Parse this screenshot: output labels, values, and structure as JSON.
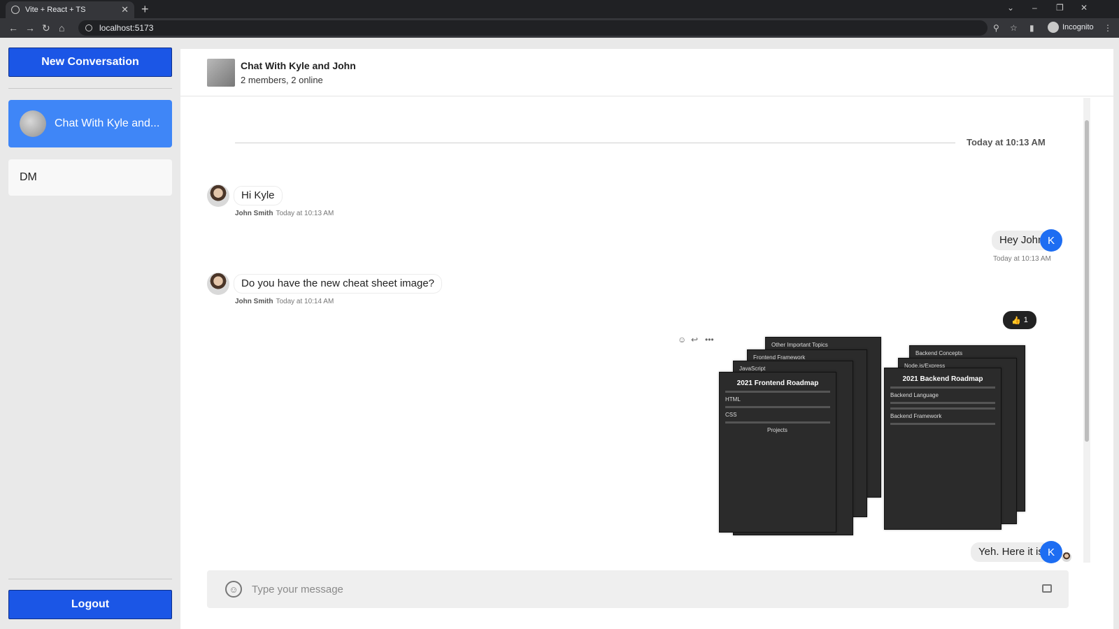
{
  "browser": {
    "tab_title": "Vite + React + TS",
    "url": "localhost:5173",
    "mode_label": "Incognito"
  },
  "sidebar": {
    "new_conversation_label": "New Conversation",
    "conversations": [
      {
        "label": "Chat With Kyle and...",
        "active": true
      },
      {
        "label": "DM",
        "active": false
      }
    ],
    "logout_label": "Logout"
  },
  "chat": {
    "title": "Chat With Kyle and John",
    "subtitle": "2 members, 2 online",
    "date_divider": "Today at 10:13 AM",
    "messages": [
      {
        "text": "Hi Kyle",
        "author": "John Smith",
        "time": "Today at 10:13 AM",
        "direction": "in"
      },
      {
        "text": "Hey John",
        "author": "",
        "time": "Today at 10:13 AM",
        "direction": "out",
        "avatar_letter": "K"
      },
      {
        "text": "Do you have the new cheat sheet image?",
        "author": "John Smith",
        "time": "Today at 10:14 AM",
        "direction": "in"
      },
      {
        "text": "Yeh. Here it is",
        "author": "",
        "time": "",
        "direction": "out",
        "avatar_letter": "K"
      }
    ],
    "reaction": {
      "emoji": "👍",
      "count": "1"
    },
    "image_sheets": {
      "frontend_title": "2021 Frontend Roadmap",
      "frontend_sections": [
        "Other Important Topics",
        "Frontend Framework",
        "JavaScript",
        "HTML",
        "CSS",
        "Projects"
      ],
      "backend_title": "2021 Backend Roadmap",
      "backend_sections": [
        "Backend Concepts",
        "Node.js/Express",
        "Backend Language",
        "Backend Framework"
      ]
    }
  },
  "composer": {
    "placeholder": "Type your message"
  },
  "colors": {
    "primary": "#1b56e6",
    "active_conversation": "#3f86f7",
    "avatar_k": "#1d6df2"
  },
  "icons": {
    "emoji": "smiley-icon",
    "image": "image-icon",
    "reply": "reply-icon",
    "more": "more-icon"
  }
}
